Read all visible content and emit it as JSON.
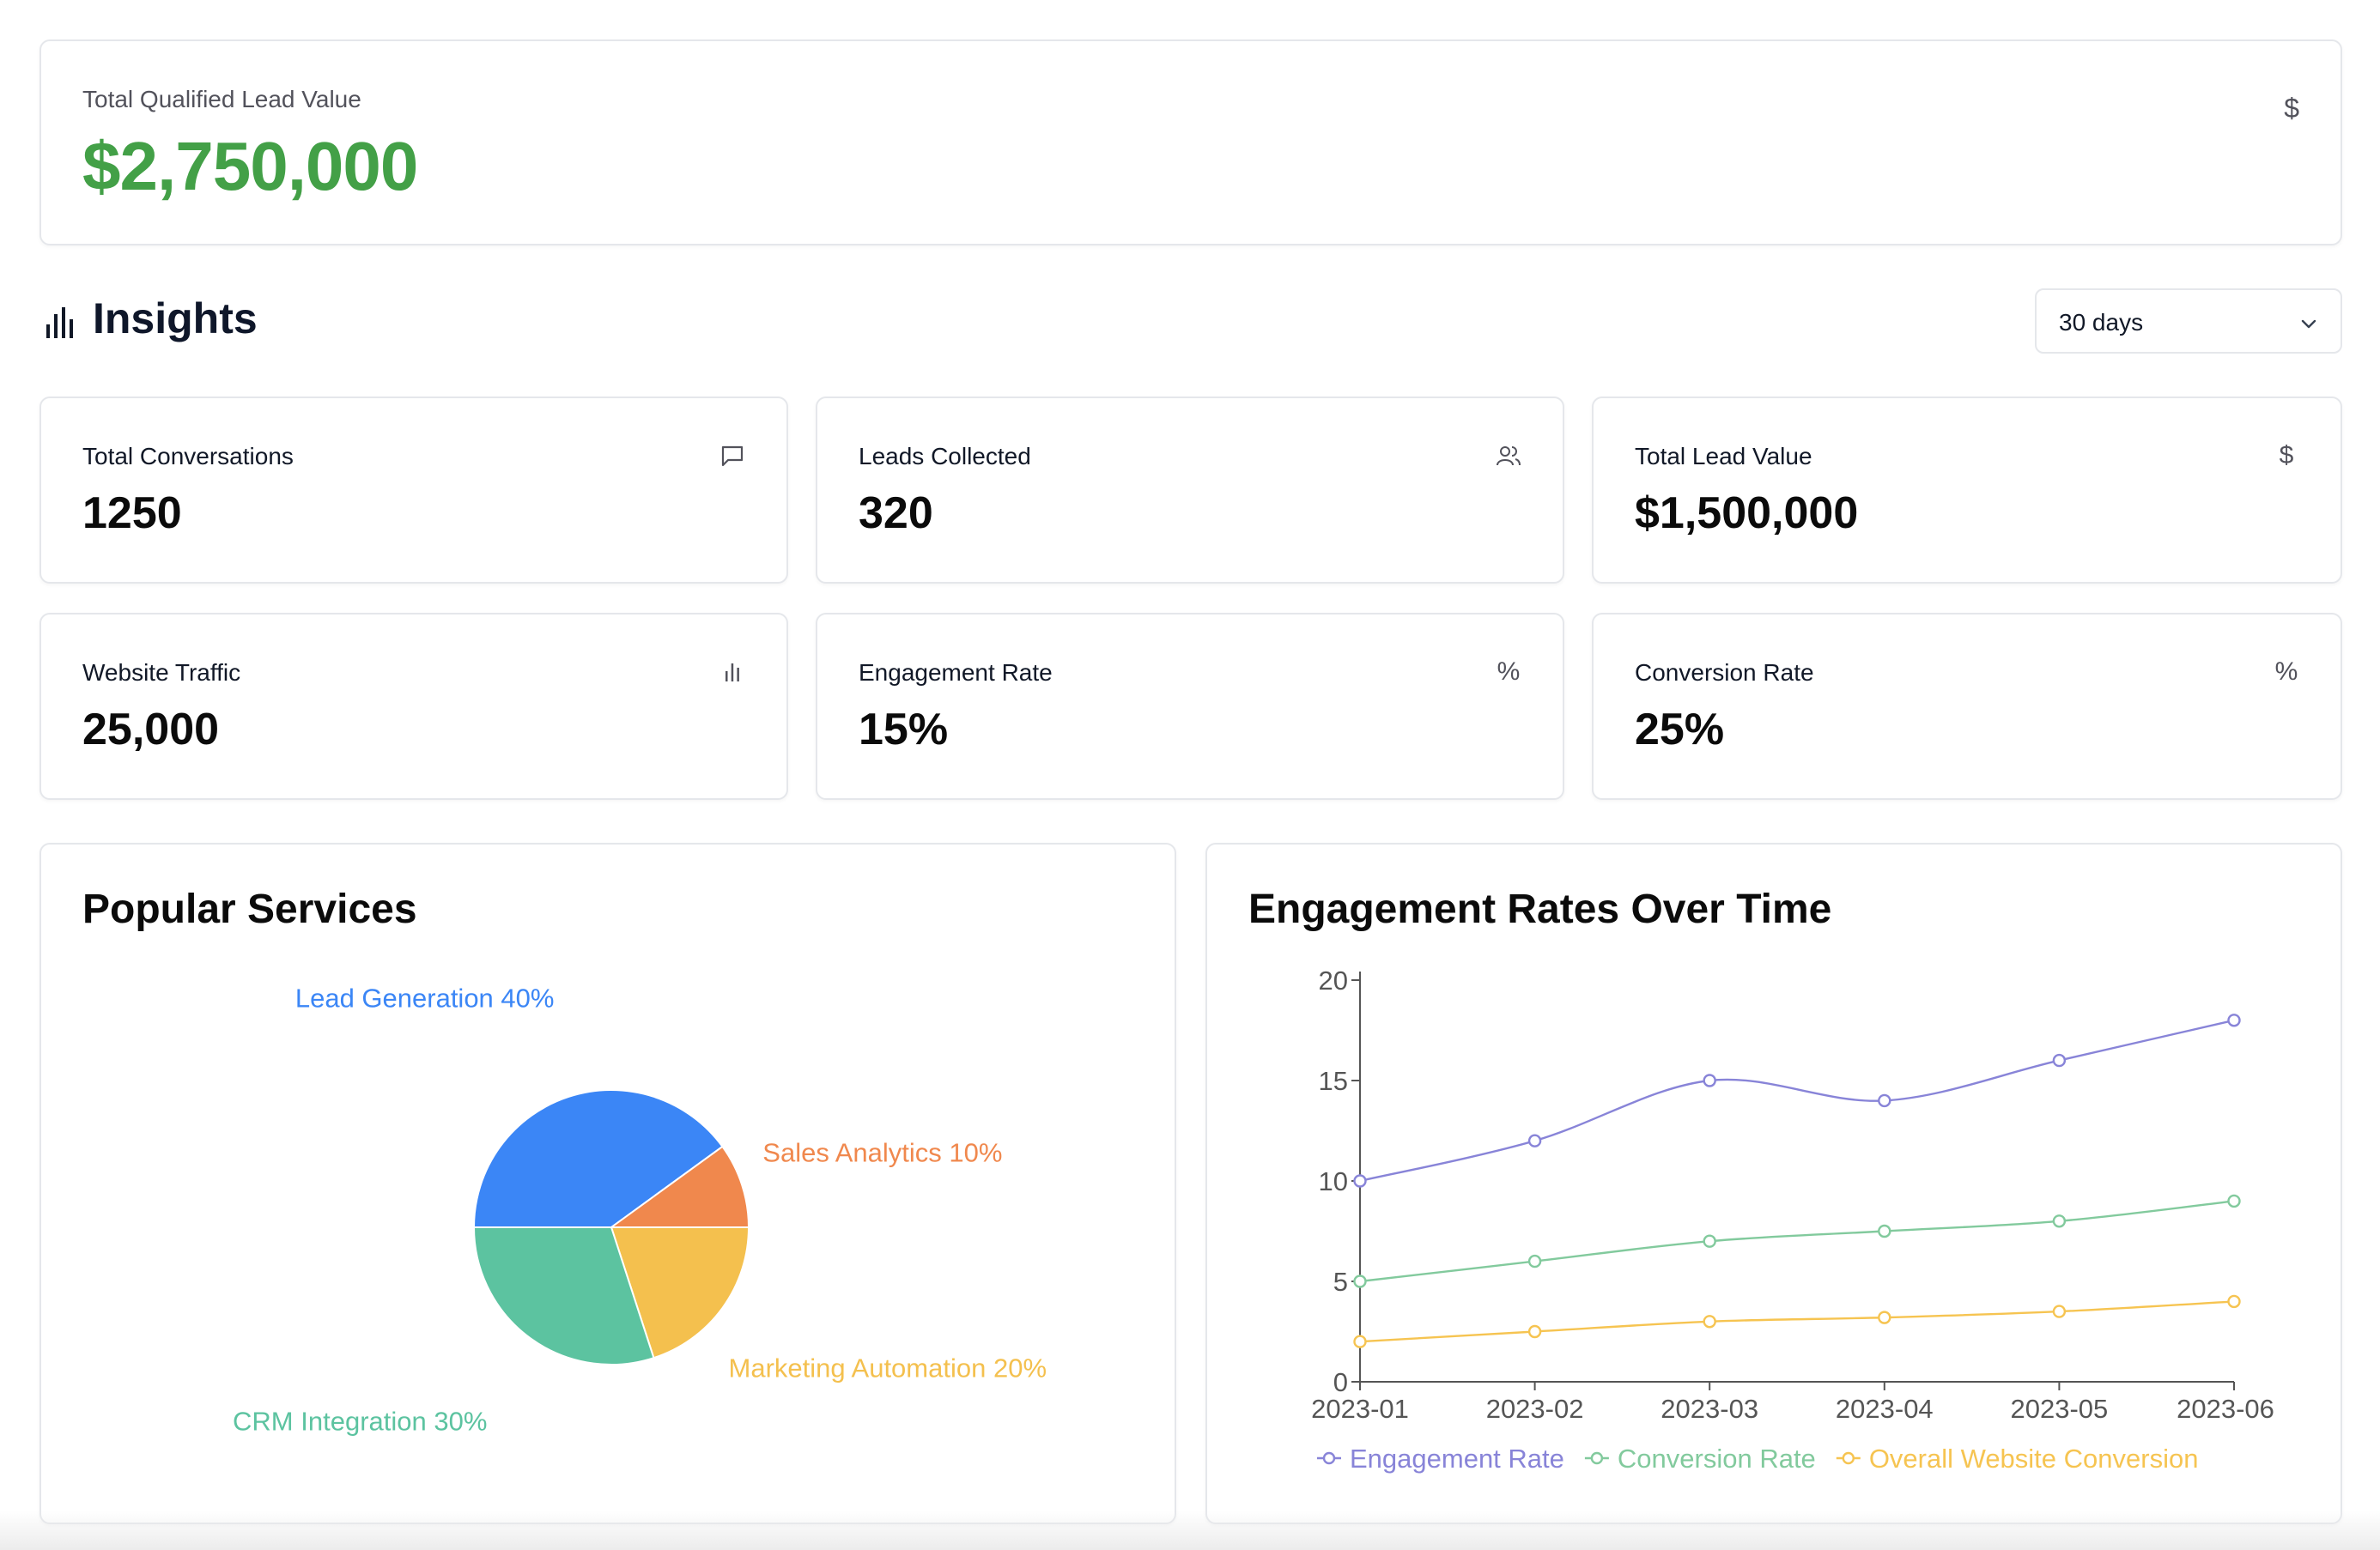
{
  "hero": {
    "label": "Total Qualified Lead Value",
    "value": "$2,750,000",
    "icon": "dollar-icon",
    "value_color": "#43a047"
  },
  "insights": {
    "title": "Insights",
    "range_select": {
      "selected": "30 days"
    }
  },
  "stats": [
    {
      "label": "Total Conversations",
      "value": "1250",
      "icon": "message-icon"
    },
    {
      "label": "Leads Collected",
      "value": "320",
      "icon": "users-icon"
    },
    {
      "label": "Total Lead Value",
      "value": "$1,500,000",
      "icon": "dollar-icon"
    },
    {
      "label": "Website Traffic",
      "value": "25,000",
      "icon": "bar-chart-icon"
    },
    {
      "label": "Engagement Rate",
      "value": "15%",
      "icon": "percent-icon"
    },
    {
      "label": "Conversion Rate",
      "value": "25%",
      "icon": "percent-icon"
    }
  ],
  "icons": {
    "dollar": "$",
    "percent": "%"
  },
  "charts": {
    "pie_title": "Popular Services",
    "line_title": "Engagement Rates Over Time"
  },
  "chart_data": [
    {
      "type": "pie",
      "title": "Popular Services",
      "slices": [
        {
          "label": "Lead Generation 40%",
          "name": "Lead Generation",
          "value": 40,
          "color": "#3b86f6"
        },
        {
          "label": "Sales Analytics 10%",
          "name": "Sales Analytics",
          "value": 10,
          "color": "#f0884d"
        },
        {
          "label": "Marketing Automation 20%",
          "name": "Marketing Automation",
          "value": 20,
          "color": "#f4c04e"
        },
        {
          "label": "CRM Integration 30%",
          "name": "CRM Integration",
          "value": 30,
          "color": "#5cc3a0"
        }
      ]
    },
    {
      "type": "line",
      "title": "Engagement Rates Over Time",
      "x": [
        "2023-01",
        "2023-02",
        "2023-03",
        "2023-04",
        "2023-05",
        "2023-06"
      ],
      "ylim": [
        0,
        20
      ],
      "yticks": [
        "0",
        "5",
        "10",
        "15",
        "20"
      ],
      "grid": false,
      "legend": "bottom",
      "series": [
        {
          "name": "Engagement Rate",
          "values": [
            10,
            12,
            15,
            14,
            16,
            18
          ],
          "color": "#8884d8"
        },
        {
          "name": "Conversion Rate",
          "values": [
            5,
            6,
            7,
            7.5,
            8,
            9
          ],
          "color": "#82ca9d"
        },
        {
          "name": "Overall Website Conversion",
          "values": [
            2,
            2.5,
            3,
            3.2,
            3.5,
            4
          ],
          "color": "#f6c451"
        }
      ]
    }
  ]
}
